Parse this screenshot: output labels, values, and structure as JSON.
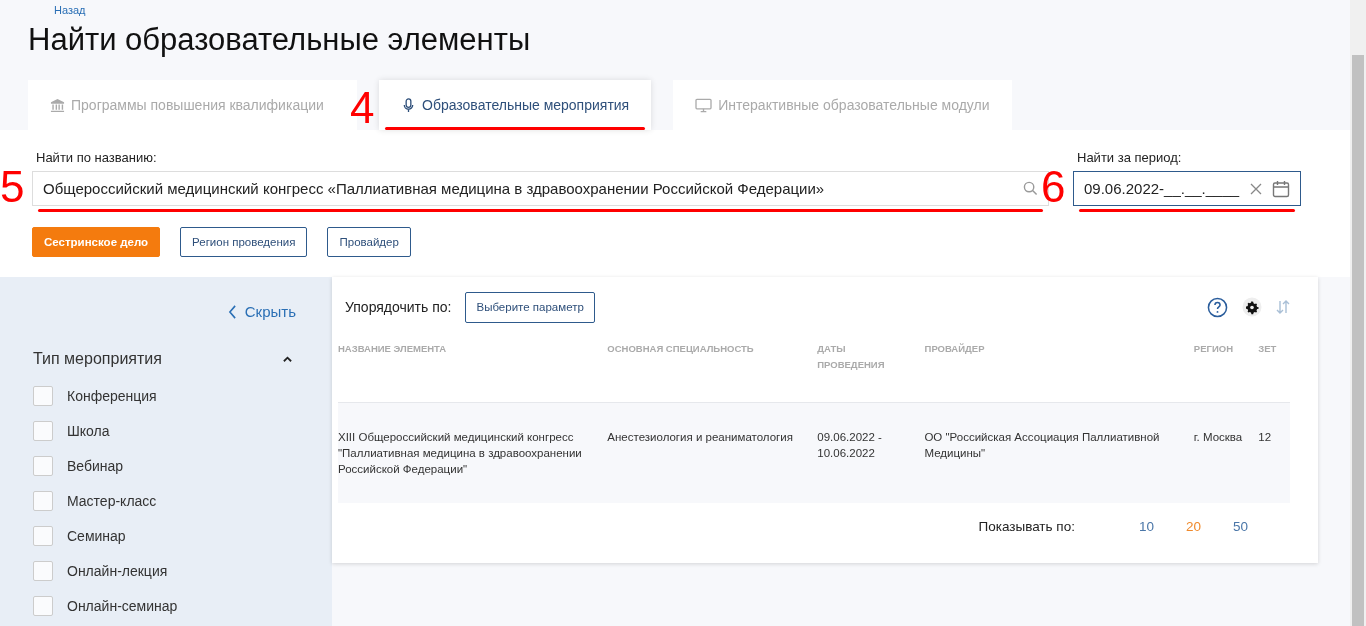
{
  "back_link": "Назад",
  "title": "Найти образовательные элементы",
  "tabs": [
    {
      "label": "Программы повышения квалификации",
      "kind": "bank",
      "selected": false
    },
    {
      "label": "Образовательные мероприятия",
      "kind": "mic",
      "selected": true,
      "annotation": "4"
    },
    {
      "label": "Интерактивные образовательные модули",
      "kind": "monitor",
      "selected": false
    }
  ],
  "search": {
    "label": "Найти по названию:",
    "value": "Общероссийский медицинский конгресс «Паллиативная медицина в здравоохранении Российской Федерации»",
    "annotation": "5"
  },
  "period": {
    "label": "Найти за период:",
    "value": "09.06.2022-__.__.____",
    "annotation": "6"
  },
  "filters": [
    {
      "label": "Сестринское дело",
      "selected": true
    },
    {
      "label": "Регион проведения",
      "selected": false
    },
    {
      "label": "Провайдер",
      "selected": false
    }
  ],
  "sidebar": {
    "hide_label": "Скрыть",
    "section": {
      "title": "Тип мероприятия",
      "expanded": true,
      "items": [
        {
          "label": "Конференция",
          "checked": false
        },
        {
          "label": "Школа",
          "checked": false
        },
        {
          "label": "Вебинар",
          "checked": false
        },
        {
          "label": "Мастер-класс",
          "checked": false
        },
        {
          "label": "Семинар",
          "checked": false
        },
        {
          "label": "Онлайн-лекция",
          "checked": false
        },
        {
          "label": "Онлайн-семинар",
          "checked": false
        }
      ]
    }
  },
  "sort": {
    "label": "Упорядочить по:",
    "button": "Выберите параметр"
  },
  "table": {
    "columns": [
      "НАЗВАНИЕ ЭЛЕМЕНТА",
      "ОСНОВНАЯ СПЕЦИАЛЬНОСТЬ",
      "ДАТЫ ПРОВЕДЕНИЯ",
      "ПРОВАЙДЕР",
      "РЕГИОН",
      "ЗЕТ"
    ],
    "rows": [
      [
        "XIII Общероссийский медицинский конгресс \"Паллиативная медицина в здравоохранении Российской Федерации\"",
        "Анестезиология и реаниматология",
        "09.06.2022 - 10.06.2022",
        "ОО \"Российская Ассоциация Паллиативной Медицины\"",
        "г. Москва",
        "12"
      ]
    ]
  },
  "pagination": {
    "label": "Показывать по:",
    "sizes": [
      {
        "label": "10",
        "selected": false
      },
      {
        "label": "20",
        "selected": true
      },
      {
        "label": "50",
        "selected": false
      }
    ]
  }
}
